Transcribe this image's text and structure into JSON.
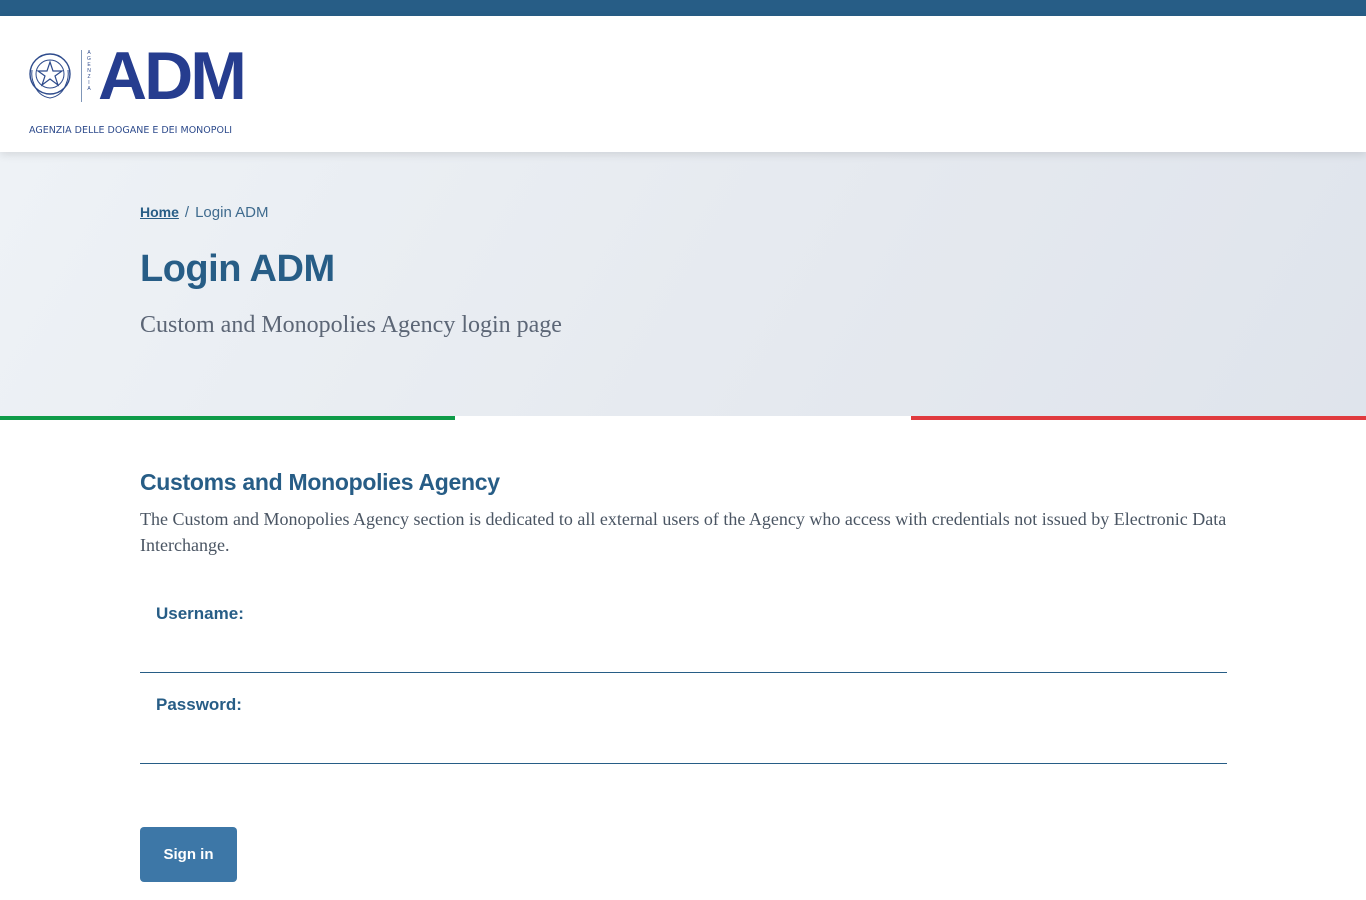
{
  "header": {
    "logo_text": "ADM",
    "logo_vertical": "AGENZIA",
    "logo_subtitle": "AGENZIA DELLE DOGANE E DEI MONOPOLI"
  },
  "breadcrumb": {
    "home": "Home",
    "separator": "/",
    "current": "Login ADM"
  },
  "hero": {
    "title": "Login ADM",
    "subtitle": "Custom and Monopolies Agency login page"
  },
  "section": {
    "title": "Customs and Monopolies Agency",
    "description": "The Custom and Monopolies Agency section is dedicated to all external users of the Agency who access with credentials not issued by Electronic Data Interchange."
  },
  "form": {
    "username_label": "Username:",
    "username_value": "",
    "password_label": "Password:",
    "password_value": "",
    "submit_label": "Sign in"
  },
  "colors": {
    "primary": "#275d86",
    "logo_blue": "#263d8f",
    "button": "#3d77a7",
    "flag_green": "#0e9b48",
    "flag_white": "#ffffff",
    "flag_red": "#e03a3e"
  }
}
